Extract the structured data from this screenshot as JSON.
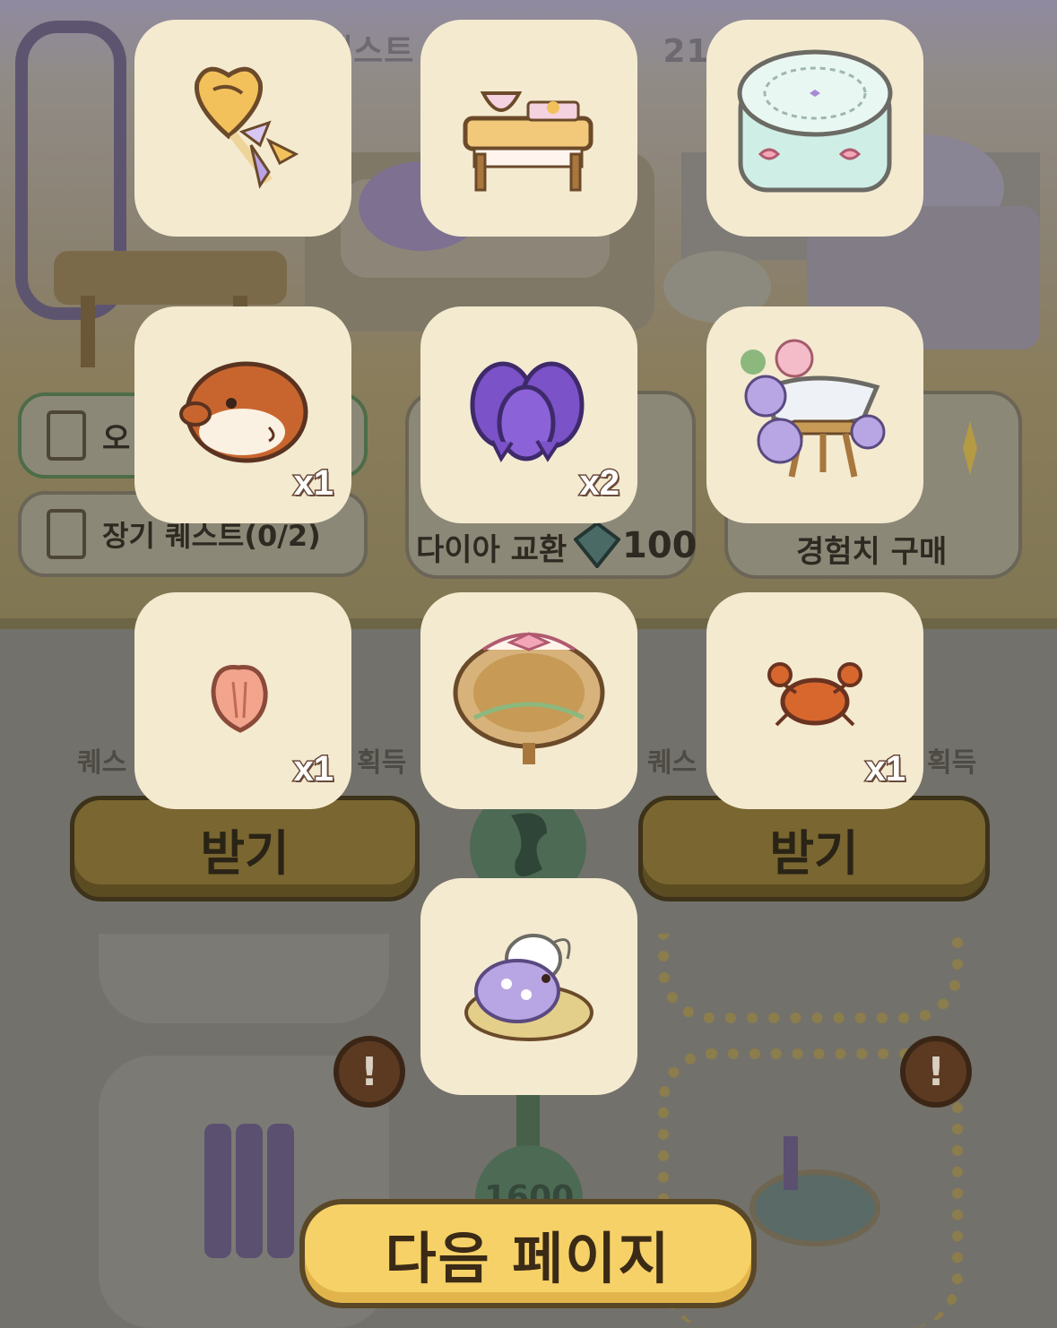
{
  "background": {
    "title_fragment": "퀘스트",
    "title_time_fragment": "21시",
    "pills": [
      {
        "label": "오",
        "style": "green"
      },
      {
        "label": "장기 퀘스트(0/2)",
        "style": "plain"
      }
    ],
    "shop": {
      "diamond_exchange_label": "다이아 교환",
      "diamond_price": "100",
      "exp_buy_label": "경험치 구매"
    },
    "rewards": [
      {
        "left_text": "퀘스",
        "right_text": "획득"
      },
      {
        "left_text": "퀘스",
        "right_text": "획득"
      }
    ],
    "receive_buttons": [
      "받기",
      "받기"
    ],
    "node_label": "1600",
    "alert_icon": "exclamation-icon"
  },
  "reward_tiles": [
    {
      "name": "heart-wand-item",
      "icon": "heart-lollipop-wand",
      "quantity": ""
    },
    {
      "name": "tea-table-item",
      "icon": "tea-table-with-cup",
      "quantity": ""
    },
    {
      "name": "lace-cake-item",
      "icon": "mint-lace-cake-table",
      "quantity": ""
    },
    {
      "name": "pufferfish-item",
      "icon": "pufferfish",
      "quantity": "x1"
    },
    {
      "name": "purple-berry-item",
      "icon": "purple-berries",
      "quantity": "x2"
    },
    {
      "name": "hydrangea-basin-item",
      "icon": "hydrangea-basin-stand",
      "quantity": ""
    },
    {
      "name": "seashell-item",
      "icon": "pink-seashell",
      "quantity": "x1"
    },
    {
      "name": "flower-arch-item",
      "icon": "ribbon-flower-arch",
      "quantity": ""
    },
    {
      "name": "crab-item",
      "icon": "orange-crab",
      "quantity": "x1"
    },
    {
      "name": "bird-hydrangea-item",
      "icon": "bird-with-hydrangea-cushion",
      "quantity": ""
    }
  ],
  "next_page_button": "다음 페이지",
  "colors": {
    "tile_bg": "#f4ead0",
    "next_button": "#f6d167",
    "overlay": "#6d6b64"
  }
}
